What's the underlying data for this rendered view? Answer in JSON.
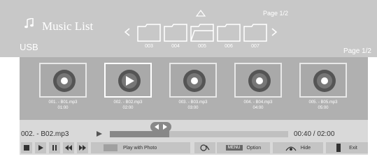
{
  "header": {
    "title": "Music List",
    "source": "USB",
    "page_top": "Page 1/2",
    "page_right": "Page 1/2"
  },
  "folders": [
    {
      "label": "003"
    },
    {
      "label": "004"
    },
    {
      "label": "005"
    },
    {
      "label": "006"
    },
    {
      "label": "007"
    }
  ],
  "tiles": [
    {
      "name": "001. - B01.mp3",
      "duration": "01:00"
    },
    {
      "name": "002. - B02.mp3",
      "duration": "02:00"
    },
    {
      "name": "003. - B03.mp3",
      "duration": "03:00"
    },
    {
      "name": "004. - B04.mp3",
      "duration": "04:00"
    },
    {
      "name": "005. - B05.mp3",
      "duration": "05:00"
    }
  ],
  "player": {
    "track": "002. - B02.mp3",
    "time": "00:40 / 02:00",
    "progress_fraction": 0.333
  },
  "controls": {
    "play_with_photo": "Play with Photo",
    "menu_tag": "MENU",
    "option": "Option",
    "hide": "Hide",
    "exit": "Exit"
  },
  "icons": {
    "title": "music-note-icon",
    "tile": "disc-icon",
    "selected_tile": "play-icon"
  }
}
